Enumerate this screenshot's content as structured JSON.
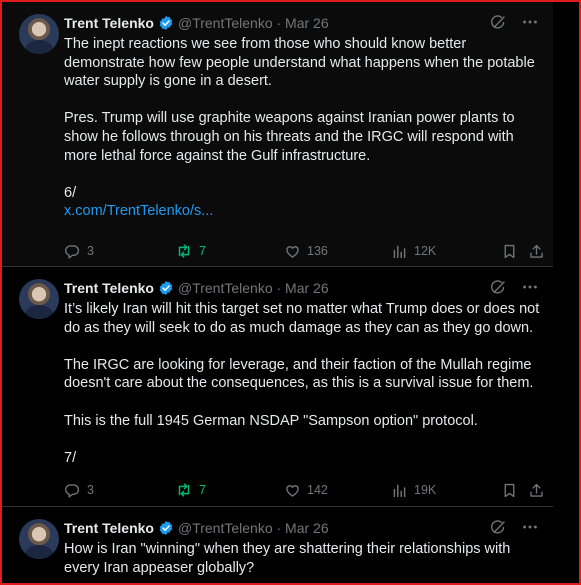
{
  "tweets": [
    {
      "author_name": "Trent Telenko",
      "handle_date": "@TrentTelenko · Mar 26",
      "paragraphs": [
        "The inept reactions we see from those who should know better demonstrate how few people understand what happens when the potable water supply is gone in a desert.",
        "Pres. Trump will use graphite weapons against Iranian power plants to show he follows through on his threats and the IRGC will respond with more lethal force against the Gulf infrastructure.",
        "6/"
      ],
      "link_text": "x.com/TrentTelenko/s...",
      "replies": "3",
      "reposts": "7",
      "likes": "136",
      "views": "12K"
    },
    {
      "author_name": "Trent Telenko",
      "handle_date": "@TrentTelenko · Mar 26",
      "paragraphs": [
        "It’s likely Iran will hit this target set no matter what Trump does or does not do as they will seek to do as much damage as they can as they go down.",
        "The IRGC are looking for leverage, and their faction of the Mullah regime doesn't care about the consequences, as this is a survival issue for them.",
        "This is the full 1945 German NSDAP \"Sampson option\" protocol.",
        "7/"
      ],
      "replies": "3",
      "reposts": "7",
      "likes": "142",
      "views": "19K"
    },
    {
      "author_name": "Trent Telenko",
      "handle_date": "@TrentTelenko · Mar 26",
      "paragraphs": [
        "How is Iran \"winning\" when they are shattering their relationships with every Iran appeaser globally?"
      ]
    }
  ],
  "icons": {
    "verified": "verified-badge-icon",
    "grok": "grok-icon",
    "more": "more-icon",
    "reply": "reply-icon",
    "repost": "repost-icon",
    "like": "like-icon",
    "views": "views-icon",
    "bookmark": "bookmark-icon",
    "share": "share-icon"
  },
  "colors": {
    "background": "#000000",
    "text": "#e7e9ea",
    "muted": "#71767b",
    "link": "#1d9bf0",
    "repost_active": "#00ba7c",
    "verified": "#1d9bf0",
    "frame": "#e01b1b"
  }
}
